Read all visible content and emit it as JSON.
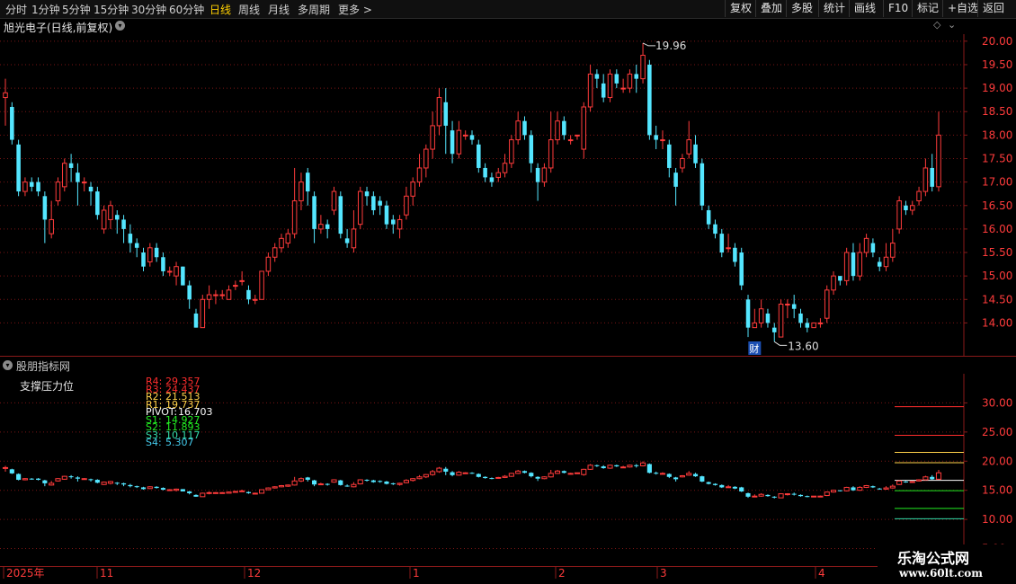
{
  "toolbar": {
    "periods": [
      "分时",
      "1分钟",
      "5分钟",
      "15分钟",
      "30分钟",
      "60分钟",
      "日线",
      "周线",
      "月线",
      "多周期",
      "更多 >"
    ],
    "active_period": "日线",
    "right_buttons": [
      "复权",
      "叠加",
      "多股",
      "统计",
      "画线",
      "F10",
      "标记",
      "+自选",
      "返回"
    ]
  },
  "stock": {
    "title": "旭光电子(日线,前复权)"
  },
  "chart_data": [
    {
      "type": "candlestick",
      "title": "旭光电子(日线,前复权)",
      "ylim": [
        13.3,
        20.15
      ],
      "y_ticks": [
        "20.00",
        "19.50",
        "19.00",
        "18.50",
        "18.00",
        "17.50",
        "17.00",
        "16.50",
        "16.00",
        "15.50",
        "15.00",
        "14.50",
        "14.00"
      ],
      "annotations": {
        "high": "19.96",
        "low": "13.60",
        "event_badge": "财"
      },
      "x_ticks": [
        "2025年",
        "11",
        "12",
        "1",
        "2",
        "3",
        "4"
      ],
      "candles": [
        [
          18.8,
          18.9,
          18.2,
          19.2
        ],
        [
          18.6,
          17.9,
          17.8,
          18.7
        ],
        [
          17.8,
          16.8,
          16.7,
          17.9
        ],
        [
          16.8,
          17.0,
          16.7,
          17.1
        ],
        [
          17.0,
          16.9,
          16.8,
          17.1
        ],
        [
          17.0,
          16.8,
          16.7,
          17.1
        ],
        [
          16.7,
          16.2,
          15.7,
          16.8
        ],
        [
          15.9,
          16.2,
          15.8,
          16.6
        ],
        [
          16.6,
          17.0,
          16.5,
          17.1
        ],
        [
          16.9,
          17.4,
          16.8,
          17.5
        ],
        [
          17.4,
          17.3,
          17.0,
          17.6
        ],
        [
          17.2,
          17.0,
          16.5,
          17.4
        ],
        [
          17.0,
          17.0,
          16.8,
          17.1
        ],
        [
          16.9,
          16.8,
          16.5,
          17.0
        ],
        [
          16.8,
          16.3,
          16.2,
          16.9
        ],
        [
          16.0,
          16.4,
          15.9,
          16.5
        ],
        [
          16.2,
          16.5,
          16.0,
          16.6
        ],
        [
          16.3,
          16.2,
          15.9,
          16.4
        ],
        [
          16.2,
          16.0,
          15.7,
          16.3
        ],
        [
          15.9,
          15.7,
          15.5,
          16.1
        ],
        [
          15.7,
          15.6,
          15.4,
          15.8
        ],
        [
          15.5,
          15.2,
          15.1,
          15.6
        ],
        [
          15.3,
          15.6,
          15.2,
          15.7
        ],
        [
          15.6,
          15.4,
          15.3,
          15.7
        ],
        [
          15.4,
          15.1,
          15.0,
          15.5
        ],
        [
          15.1,
          15.1,
          15.0,
          15.2
        ],
        [
          15.0,
          15.2,
          14.8,
          15.3
        ],
        [
          15.2,
          14.8,
          14.8,
          15.2
        ],
        [
          14.8,
          14.5,
          14.3,
          14.9
        ],
        [
          14.2,
          13.9,
          13.9,
          14.3
        ],
        [
          13.9,
          14.5,
          13.9,
          14.6
        ],
        [
          14.5,
          14.6,
          14.3,
          14.8
        ],
        [
          14.6,
          14.6,
          14.4,
          14.7
        ],
        [
          14.6,
          14.6,
          14.5,
          14.7
        ],
        [
          14.5,
          14.7,
          14.5,
          14.8
        ],
        [
          14.8,
          14.8,
          14.7,
          14.9
        ],
        [
          14.9,
          14.9,
          14.8,
          15.1
        ],
        [
          14.7,
          14.5,
          14.4,
          14.8
        ],
        [
          14.5,
          14.5,
          14.4,
          14.6
        ],
        [
          14.5,
          15.1,
          14.5,
          15.1
        ],
        [
          15.1,
          15.4,
          15.0,
          15.5
        ],
        [
          15.4,
          15.6,
          15.3,
          15.7
        ],
        [
          15.6,
          15.8,
          15.5,
          15.9
        ],
        [
          15.7,
          15.9,
          15.6,
          16.0
        ],
        [
          15.9,
          16.6,
          15.8,
          17.3
        ],
        [
          16.6,
          17.0,
          16.4,
          17.2
        ],
        [
          17.2,
          16.8,
          16.5,
          17.3
        ],
        [
          16.7,
          16.0,
          15.7,
          16.8
        ],
        [
          16.0,
          16.1,
          15.9,
          16.3
        ],
        [
          16.1,
          16.0,
          15.8,
          16.2
        ],
        [
          16.4,
          16.8,
          16.3,
          16.9
        ],
        [
          16.7,
          15.9,
          15.8,
          16.8
        ],
        [
          15.8,
          15.7,
          15.6,
          16.0
        ],
        [
          15.6,
          16.0,
          15.5,
          16.4
        ],
        [
          16.1,
          16.8,
          16.0,
          16.9
        ],
        [
          16.8,
          16.7,
          16.5,
          16.9
        ],
        [
          16.7,
          16.4,
          16.3,
          16.8
        ],
        [
          16.6,
          16.5,
          16.3,
          16.7
        ],
        [
          16.5,
          16.1,
          16.0,
          16.6
        ],
        [
          16.2,
          16.1,
          15.9,
          16.3
        ],
        [
          16.0,
          16.2,
          15.8,
          16.3
        ],
        [
          16.3,
          16.7,
          16.2,
          16.9
        ],
        [
          16.7,
          17.0,
          16.5,
          17.1
        ],
        [
          17.0,
          17.3,
          16.9,
          17.6
        ],
        [
          17.3,
          17.7,
          17.1,
          17.8
        ],
        [
          17.7,
          18.2,
          17.5,
          18.5
        ],
        [
          18.2,
          18.8,
          18.0,
          19.0
        ],
        [
          18.7,
          18.2,
          17.6,
          19.0
        ],
        [
          18.1,
          17.6,
          17.4,
          18.3
        ],
        [
          17.6,
          18.1,
          17.5,
          18.3
        ],
        [
          18.0,
          18.0,
          17.9,
          18.1
        ],
        [
          18.0,
          17.9,
          17.8,
          18.1
        ],
        [
          17.8,
          17.3,
          17.2,
          17.9
        ],
        [
          17.3,
          17.1,
          17.0,
          17.4
        ],
        [
          17.1,
          17.0,
          16.9,
          17.2
        ],
        [
          17.1,
          17.2,
          17.0,
          17.3
        ],
        [
          17.2,
          17.4,
          17.1,
          17.6
        ],
        [
          17.4,
          17.9,
          17.3,
          18.0
        ],
        [
          17.9,
          18.3,
          17.8,
          18.5
        ],
        [
          18.3,
          18.0,
          17.9,
          18.4
        ],
        [
          18.0,
          17.4,
          17.2,
          18.1
        ],
        [
          17.3,
          17.0,
          16.6,
          17.4
        ],
        [
          17.0,
          17.3,
          16.9,
          17.4
        ],
        [
          17.3,
          17.9,
          17.2,
          18.5
        ],
        [
          17.9,
          18.3,
          17.8,
          18.5
        ],
        [
          18.3,
          18.0,
          17.9,
          18.4
        ],
        [
          17.9,
          17.9,
          17.8,
          18.0
        ],
        [
          18.0,
          18.0,
          17.9,
          18.0
        ],
        [
          17.7,
          18.6,
          17.5,
          18.7
        ],
        [
          18.6,
          19.3,
          18.5,
          19.5
        ],
        [
          19.3,
          19.2,
          19.0,
          19.4
        ],
        [
          19.1,
          18.8,
          18.7,
          19.3
        ],
        [
          18.8,
          19.3,
          18.7,
          19.4
        ],
        [
          19.3,
          19.1,
          19.0,
          19.4
        ],
        [
          19.0,
          19.0,
          18.9,
          19.2
        ],
        [
          19.0,
          19.3,
          18.9,
          19.4
        ],
        [
          19.3,
          19.2,
          18.9,
          19.5
        ],
        [
          19.2,
          19.7,
          19.1,
          19.96
        ],
        [
          19.5,
          18.0,
          17.9,
          19.6
        ],
        [
          18.0,
          17.9,
          17.7,
          18.2
        ],
        [
          17.9,
          17.9,
          17.7,
          18.1
        ],
        [
          17.8,
          17.3,
          17.1,
          17.9
        ],
        [
          17.2,
          16.9,
          16.5,
          17.3
        ],
        [
          17.3,
          17.5,
          17.2,
          17.6
        ],
        [
          17.6,
          17.9,
          17.5,
          18.3
        ],
        [
          17.8,
          17.4,
          17.3,
          18.0
        ],
        [
          17.4,
          16.5,
          16.4,
          17.5
        ],
        [
          16.4,
          16.1,
          16.0,
          16.5
        ],
        [
          16.1,
          15.9,
          15.8,
          16.2
        ],
        [
          15.9,
          15.5,
          15.4,
          16.0
        ],
        [
          15.6,
          15.6,
          15.5,
          15.9
        ],
        [
          15.6,
          15.3,
          15.2,
          15.7
        ],
        [
          15.5,
          14.8,
          14.7,
          15.6
        ],
        [
          14.5,
          13.9,
          13.7,
          14.6
        ],
        [
          13.9,
          14.0,
          13.9,
          14.3
        ],
        [
          14.0,
          14.3,
          13.9,
          14.5
        ],
        [
          14.2,
          14.0,
          13.9,
          14.3
        ],
        [
          13.9,
          13.8,
          13.6,
          14.0
        ],
        [
          13.7,
          14.4,
          13.7,
          14.5
        ],
        [
          14.4,
          14.4,
          14.1,
          14.5
        ],
        [
          14.4,
          14.3,
          14.1,
          14.6
        ],
        [
          14.2,
          14.0,
          13.9,
          14.3
        ],
        [
          14.0,
          13.9,
          13.8,
          14.1
        ],
        [
          13.9,
          14.0,
          13.9,
          14.0
        ],
        [
          14.0,
          14.0,
          13.9,
          14.1
        ],
        [
          14.1,
          14.7,
          14.0,
          14.8
        ],
        [
          14.7,
          15.0,
          14.6,
          15.1
        ],
        [
          15.0,
          14.9,
          14.8,
          15.0
        ],
        [
          14.9,
          15.5,
          14.8,
          15.6
        ],
        [
          15.5,
          15.0,
          14.9,
          15.7
        ],
        [
          15.0,
          15.5,
          14.9,
          15.7
        ],
        [
          15.5,
          15.8,
          15.4,
          15.9
        ],
        [
          15.7,
          15.5,
          15.4,
          15.8
        ],
        [
          15.3,
          15.2,
          15.1,
          15.4
        ],
        [
          15.2,
          15.4,
          15.1,
          15.7
        ],
        [
          15.4,
          15.7,
          15.3,
          16.0
        ],
        [
          16.0,
          16.6,
          15.9,
          16.7
        ],
        [
          16.5,
          16.4,
          16.3,
          16.6
        ],
        [
          16.4,
          16.5,
          16.3,
          16.6
        ],
        [
          16.6,
          16.8,
          16.5,
          16.9
        ],
        [
          16.8,
          17.3,
          16.7,
          17.5
        ],
        [
          17.3,
          16.9,
          16.8,
          17.6
        ],
        [
          16.9,
          18.0,
          16.8,
          18.5
        ]
      ]
    },
    {
      "type": "candlestick",
      "title": "支撑压力位",
      "ylim": [
        2,
        35
      ],
      "y_ticks": [
        "30.00",
        "25.00",
        "20.00",
        "15.00",
        "10.00",
        "5.00"
      ],
      "levels": [
        {
          "name": "R4",
          "value": "29.357",
          "color": "#ff2d2d"
        },
        {
          "name": "R3",
          "value": "24.437",
          "color": "#ff2d2d"
        },
        {
          "name": "R2",
          "value": "21.513",
          "color": "#ffd24a"
        },
        {
          "name": "R1",
          "value": "19.737",
          "color": "#ffd24a"
        },
        {
          "name": "PIVOT",
          "value": "16.703",
          "color": "#ffffff"
        },
        {
          "name": "S1",
          "value": "14.927",
          "color": "#22ee22"
        },
        {
          "name": "S2",
          "value": "11.893",
          "color": "#22ee22"
        },
        {
          "name": "S3",
          "value": "10.117",
          "color": "#33ddaa"
        },
        {
          "name": "S4",
          "value": "5.307",
          "color": "#44ccee"
        }
      ]
    }
  ],
  "indicator": {
    "section_title": "股朋指标网",
    "name": "支撑压力位"
  },
  "colors": {
    "up": "#ff3b3b",
    "down": "#54e6ff",
    "grid": "#7a1515",
    "axis_text": "#ff3b3b"
  },
  "watermark": {
    "name": "乐淘公式网",
    "url": "www.60lt.com"
  }
}
